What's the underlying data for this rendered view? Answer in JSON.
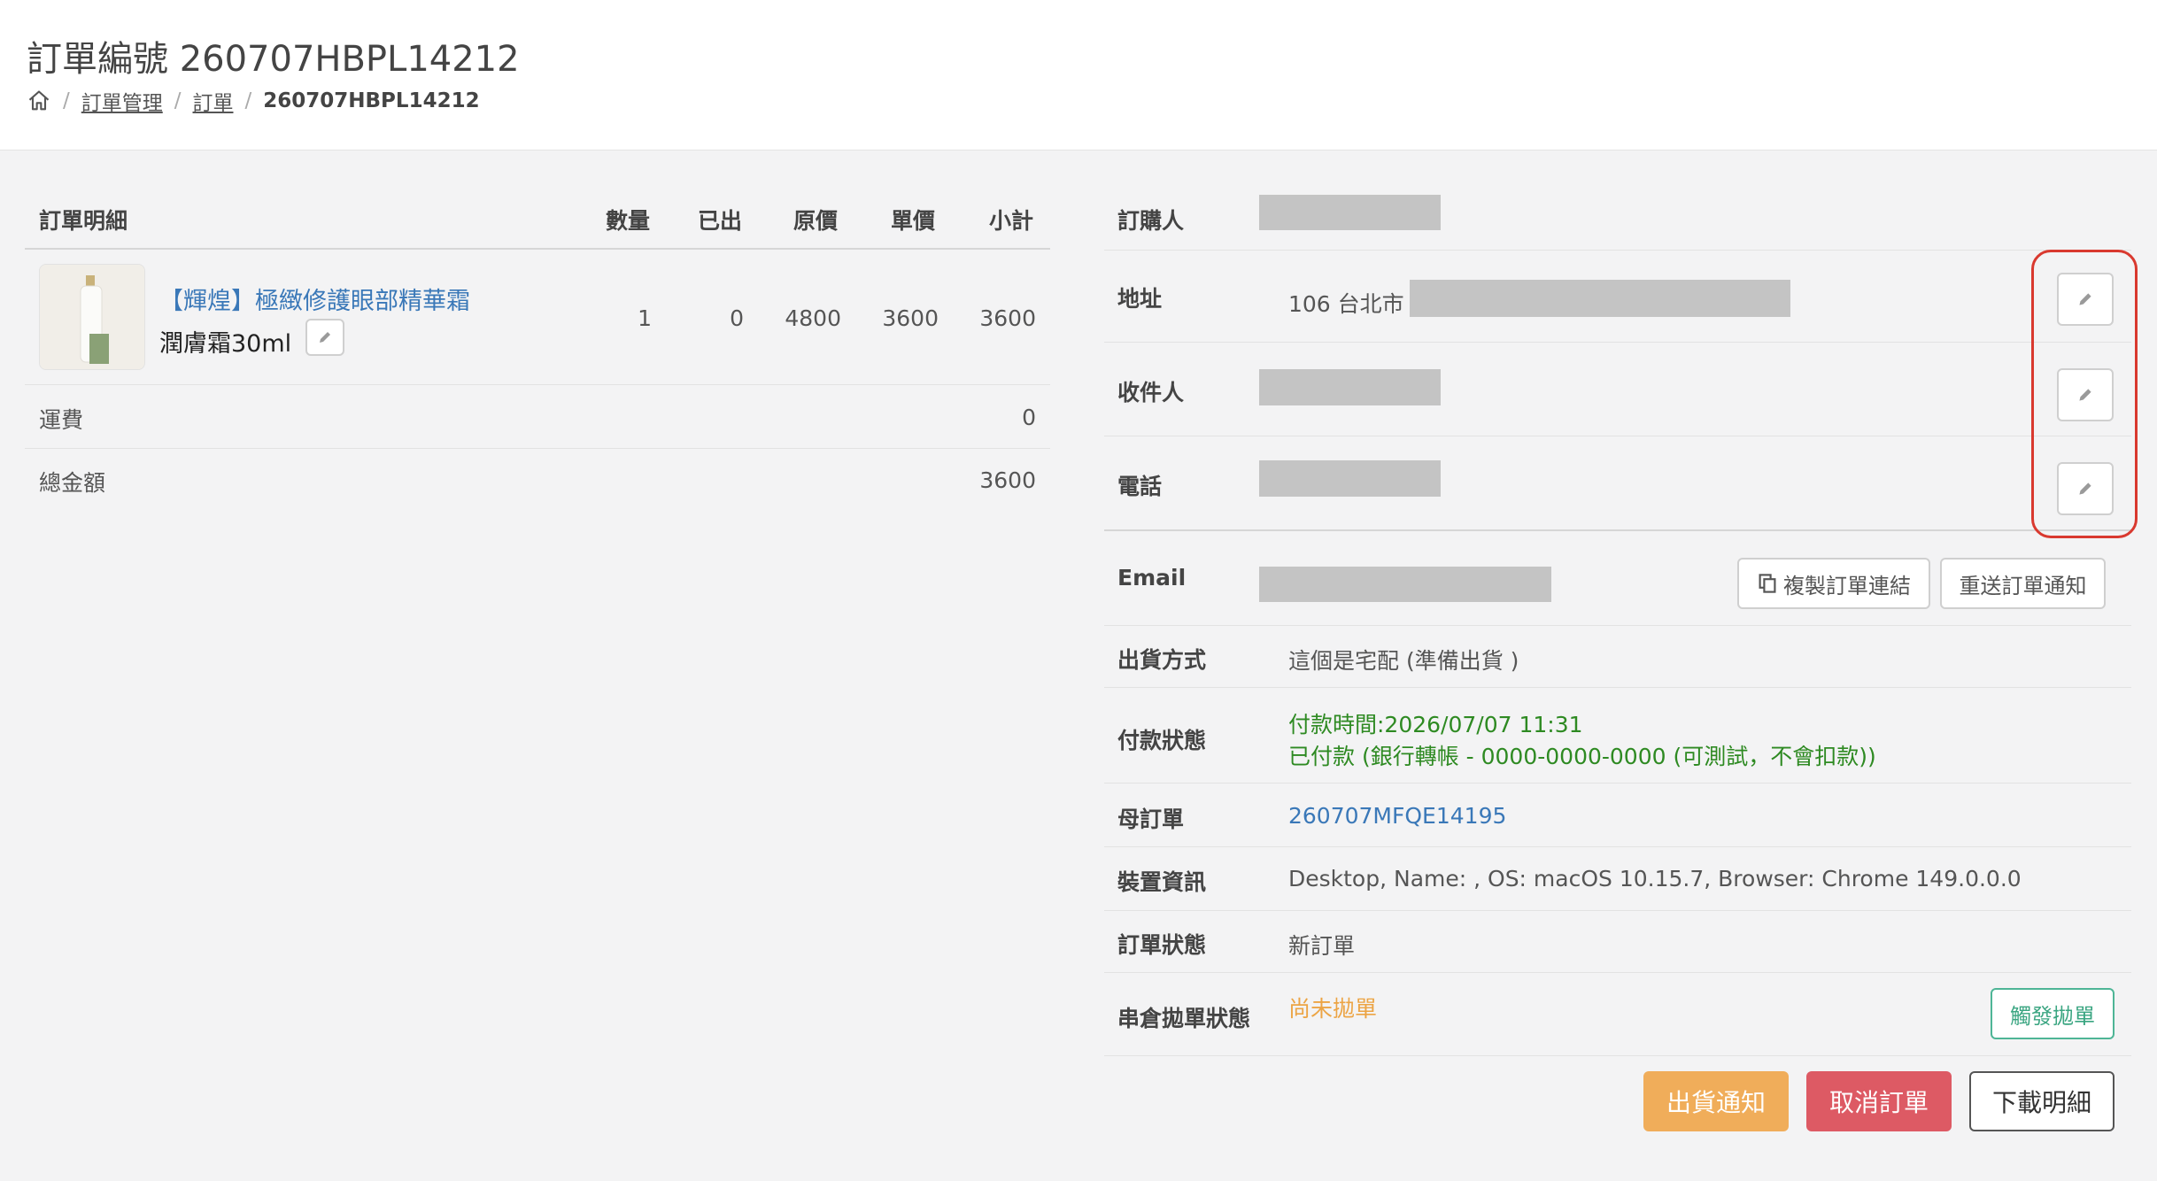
{
  "header": {
    "title": "訂單編號 260707HBPL14212",
    "breadcrumb": {
      "home_icon": "home-icon",
      "items": [
        "訂單管理",
        "訂單"
      ],
      "current": "260707HBPL14212",
      "separator": "/"
    }
  },
  "order_table": {
    "columns": {
      "detail": "訂單明細",
      "qty": "數量",
      "shipped": "已出",
      "original_price": "原價",
      "unit_price": "單價",
      "subtotal": "小計"
    },
    "items": [
      {
        "name": "【輝煌】極緻修護眼部精華霜",
        "variant": "潤膚霜30ml",
        "qty": "1",
        "shipped": "0",
        "original_price": "4800",
        "unit_price": "3600",
        "subtotal": "3600"
      }
    ],
    "shipping": {
      "label": "運費",
      "value": "0"
    },
    "total": {
      "label": "總金額",
      "value": "3600"
    }
  },
  "info": {
    "buyer": {
      "label": "訂購人"
    },
    "address": {
      "label": "地址",
      "prefix": "106 台北市"
    },
    "recipient": {
      "label": "收件人"
    },
    "phone": {
      "label": "電話"
    },
    "email": {
      "label": "Email"
    },
    "copy_link_button": "複製訂單連結",
    "resend_button": "重送訂單通知",
    "shipping_method": {
      "label": "出貨方式",
      "value": "這個是宅配 (準備出貨 )"
    },
    "payment_status": {
      "label": "付款狀態",
      "line1": "付款時間:2026/07/07 11:31",
      "line2": "已付款 (銀行轉帳 - 0000-0000-0000 (可測試，不會扣款))"
    },
    "parent_order": {
      "label": "母訂單",
      "value": "260707MFQE14195"
    },
    "device": {
      "label": "裝置資訊",
      "value": "Desktop, Name: , OS: macOS 10.15.7, Browser: Chrome 149.0.0.0"
    },
    "order_status": {
      "label": "訂單狀態",
      "value": "新訂單"
    },
    "warehouse_status": {
      "label": "串倉拋單狀態",
      "value": "尚未拋單",
      "trigger_button": "觸發拋單"
    }
  },
  "actions": {
    "ship_notice": "出貨通知",
    "cancel_order": "取消訂單",
    "download_detail": "下載明細"
  },
  "colors": {
    "link": "#3a78b8",
    "paid_green": "#2e8a22",
    "pending_orange": "#eca444",
    "ship_button": "#f0ad5a",
    "cancel_button": "#dd5a64",
    "trigger_border": "#4eb596",
    "highlight_red": "#d9392f"
  }
}
